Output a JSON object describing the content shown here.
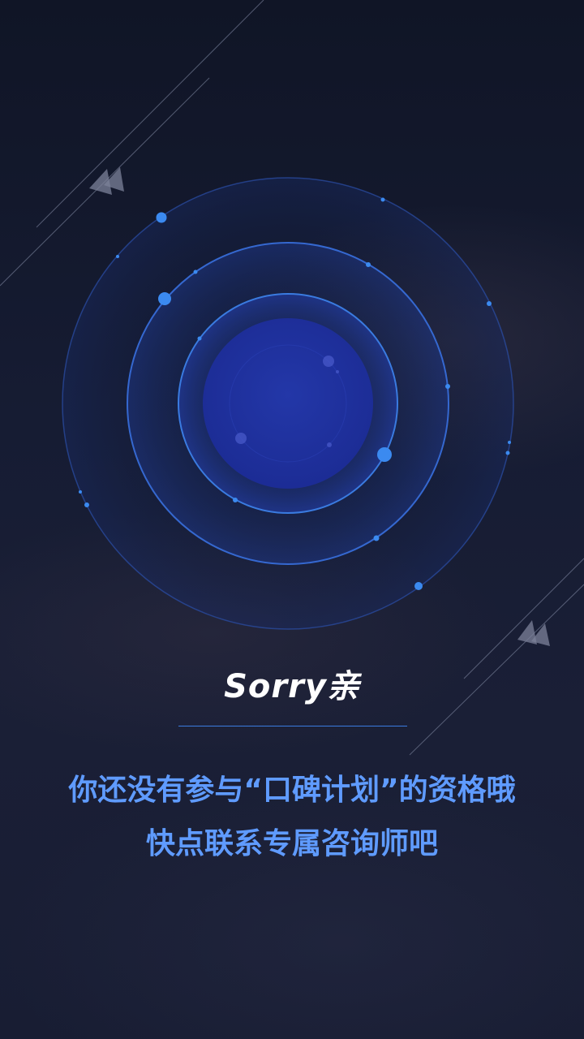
{
  "screen": {
    "headline": "Sorry亲",
    "message_line1": "你还没有参与“口碑计划”的资格哦",
    "message_line2": "快点联系专属咨询师吧"
  },
  "colors": {
    "background": "#141a2e",
    "accent_blue": "#5f9bff",
    "orbit_blue": "#3a7be0",
    "core_blue": "#1d2f9c",
    "headline": "#ffffff"
  },
  "icons": {
    "arrow_top_left": "double-arrow-icon",
    "arrow_bottom_right": "double-arrow-icon"
  }
}
